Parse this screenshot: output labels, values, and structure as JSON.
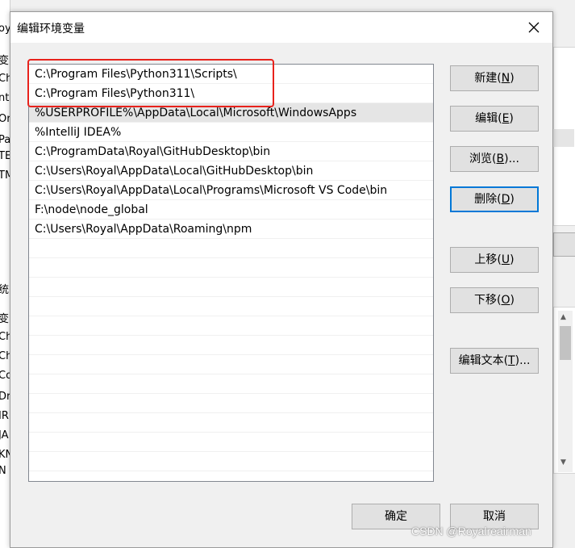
{
  "dialog": {
    "title": "编辑环境变量",
    "close_glyph": "✕"
  },
  "list": {
    "items": [
      "C:\\Program Files\\Python311\\Scripts\\",
      "C:\\Program Files\\Python311\\",
      "%USERPROFILE%\\AppData\\Local\\Microsoft\\WindowsApps",
      "%IntelliJ IDEA%",
      "C:\\ProgramData\\Royal\\GitHubDesktop\\bin",
      "C:\\Users\\Royal\\AppData\\Local\\GitHubDesktop\\bin",
      "C:\\Users\\Royal\\AppData\\Local\\Programs\\Microsoft VS Code\\bin",
      "F:\\node\\node_global",
      "C:\\Users\\Royal\\AppData\\Roaming\\npm"
    ],
    "selected_index": 2,
    "empty_rows": 12
  },
  "buttons": {
    "new": {
      "text": "新建(",
      "key": "N",
      "end": ")"
    },
    "edit": {
      "text": "编辑(",
      "key": "E",
      "end": ")"
    },
    "browse": {
      "text": "浏览(",
      "key": "B",
      "end": ")..."
    },
    "delete": {
      "text": "删除(",
      "key": "D",
      "end": ")"
    },
    "move_up": {
      "text": "上移(",
      "key": "U",
      "end": ")"
    },
    "move_down": {
      "text": "下移(",
      "key": "O",
      "end": ")"
    },
    "edit_text": {
      "text": "编辑文本(",
      "key": "T",
      "end": ")..."
    },
    "ok": "确定",
    "cancel": "取消"
  },
  "background": {
    "left_fragments": [
      "oya",
      "变",
      "Ch",
      "nt",
      "Or",
      "Pa",
      "TE",
      "TM",
      "统",
      "变",
      "Ch",
      "Ch",
      "Co",
      "Dr",
      "IR",
      "JA",
      "KN",
      "N"
    ]
  },
  "watermark": "CSDN @Royalreairman",
  "colors": {
    "highlight": "#e8221c",
    "focus": "#0078d7",
    "selected_row": "#e5e5e5"
  }
}
